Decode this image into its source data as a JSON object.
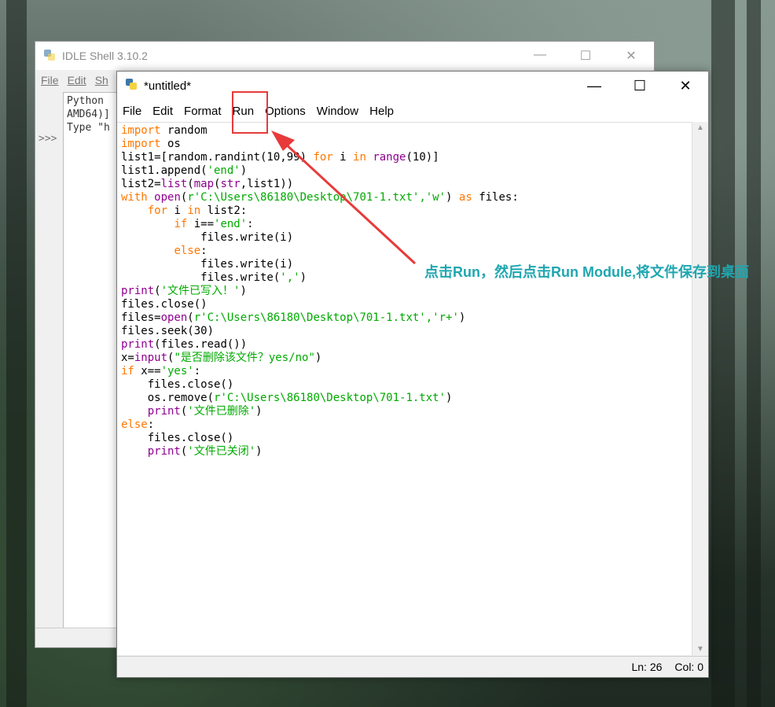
{
  "shell": {
    "title": "IDLE Shell 3.10.2",
    "menu": [
      "File",
      "Edit",
      "Sh"
    ],
    "text_lines": [
      "Python",
      "AMD64)]",
      "Type \"h"
    ],
    "prompt": ">>>"
  },
  "editor": {
    "title": "*untitled*",
    "menu": [
      "File",
      "Edit",
      "Format",
      "Run",
      "Options",
      "Window",
      "Help"
    ],
    "status": {
      "line": "Ln: 26",
      "col": "Col: 0"
    }
  },
  "window_controls": {
    "minimize": "—",
    "maximize": "☐",
    "close": "✕"
  },
  "annotation": {
    "text": "点击Run，然后点击Run Module,将文件保存到桌面"
  },
  "code_lines": [
    [
      [
        "kw",
        "import"
      ],
      [
        "df",
        " random"
      ]
    ],
    [
      [
        "kw",
        "import"
      ],
      [
        "df",
        " os"
      ]
    ],
    [
      [
        "df",
        "list1=[random.randint(10,99) "
      ],
      [
        "kw",
        "for"
      ],
      [
        "df",
        " i "
      ],
      [
        "kw",
        "in"
      ],
      [
        "df",
        " "
      ],
      [
        "bi",
        "range"
      ],
      [
        "df",
        "(10)]"
      ]
    ],
    [
      [
        "df",
        "list1.append("
      ],
      [
        "st",
        "'end'"
      ],
      [
        "df",
        ")"
      ]
    ],
    [
      [
        "df",
        "list2="
      ],
      [
        "bi",
        "list"
      ],
      [
        "df",
        "("
      ],
      [
        "bi",
        "map"
      ],
      [
        "df",
        "("
      ],
      [
        "bi",
        "str"
      ],
      [
        "df",
        ",list1))"
      ]
    ],
    [
      [
        "kw",
        "with"
      ],
      [
        "df",
        " "
      ],
      [
        "bi",
        "open"
      ],
      [
        "df",
        "("
      ],
      [
        "st",
        "r'C:\\Users\\86180\\Desktop\\701-1.txt','w'"
      ],
      [
        "df",
        ") "
      ],
      [
        "kw",
        "as"
      ],
      [
        "df",
        " files:"
      ]
    ],
    [
      [
        "df",
        "    "
      ],
      [
        "kw",
        "for"
      ],
      [
        "df",
        " i "
      ],
      [
        "kw",
        "in"
      ],
      [
        "df",
        " list2:"
      ]
    ],
    [
      [
        "df",
        "        "
      ],
      [
        "kw",
        "if"
      ],
      [
        "df",
        " i=="
      ],
      [
        "st",
        "'end'"
      ],
      [
        "df",
        ":"
      ]
    ],
    [
      [
        "df",
        "            files.write(i)"
      ]
    ],
    [
      [
        "df",
        "        "
      ],
      [
        "kw",
        "else"
      ],
      [
        "df",
        ":"
      ]
    ],
    [
      [
        "df",
        "            files.write(i)"
      ]
    ],
    [
      [
        "df",
        "            files.write("
      ],
      [
        "st",
        "','"
      ],
      [
        "df",
        ")"
      ]
    ],
    [
      [
        "bi",
        "print"
      ],
      [
        "df",
        "("
      ],
      [
        "st",
        "'文件已写入！'"
      ],
      [
        "df",
        ")"
      ]
    ],
    [
      [
        "df",
        "files.close()"
      ]
    ],
    [
      [
        "df",
        "files="
      ],
      [
        "bi",
        "open"
      ],
      [
        "df",
        "("
      ],
      [
        "st",
        "r'C:\\Users\\86180\\Desktop\\701-1.txt','r+'"
      ],
      [
        "df",
        ")"
      ]
    ],
    [
      [
        "df",
        "files.seek(30)"
      ]
    ],
    [
      [
        "bi",
        "print"
      ],
      [
        "df",
        "(files.read())"
      ]
    ],
    [
      [
        "df",
        "x="
      ],
      [
        "bi",
        "input"
      ],
      [
        "df",
        "("
      ],
      [
        "st",
        "\"是否删除该文件？yes/no\""
      ],
      [
        "df",
        ")"
      ]
    ],
    [
      [
        "kw",
        "if"
      ],
      [
        "df",
        " x=="
      ],
      [
        "st",
        "'yes'"
      ],
      [
        "df",
        ":"
      ]
    ],
    [
      [
        "df",
        "    files.close()"
      ]
    ],
    [
      [
        "df",
        "    os.remove("
      ],
      [
        "st",
        "r'C:\\Users\\86180\\Desktop\\701-1.txt'"
      ],
      [
        "df",
        ")"
      ]
    ],
    [
      [
        "df",
        "    "
      ],
      [
        "bi",
        "print"
      ],
      [
        "df",
        "("
      ],
      [
        "st",
        "'文件已删除'"
      ],
      [
        "df",
        ")"
      ]
    ],
    [
      [
        "kw",
        "else"
      ],
      [
        "df",
        ":"
      ]
    ],
    [
      [
        "df",
        "    files.close()"
      ]
    ],
    [
      [
        "df",
        "    "
      ],
      [
        "bi",
        "print"
      ],
      [
        "df",
        "("
      ],
      [
        "st",
        "'文件已关闭'"
      ],
      [
        "df",
        ")"
      ]
    ]
  ],
  "colors": {
    "keyword": "#ff7700",
    "builtin": "#900090",
    "string": "#00aa00",
    "highlight_box": "#e83a3a",
    "annotation": "#1fa6b0"
  }
}
